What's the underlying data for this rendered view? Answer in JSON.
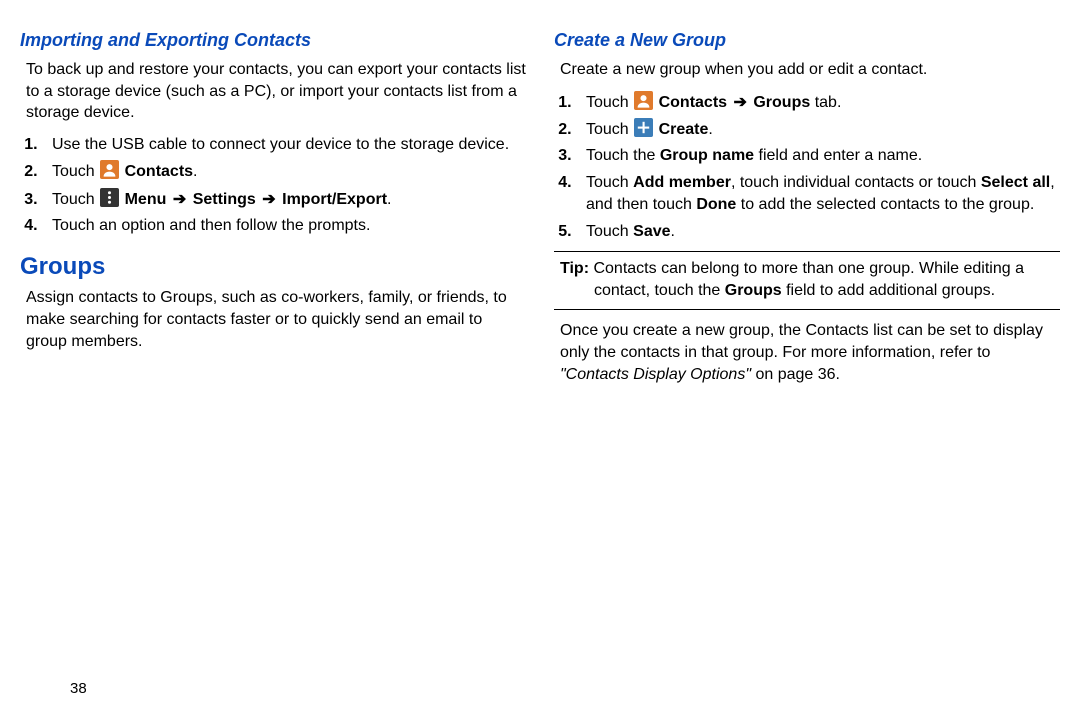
{
  "page_number": "38",
  "left": {
    "heading1": "Importing and Exporting Contacts",
    "para1": "To back up and restore your contacts, you can export your contacts list to a storage device (such as a PC), or import your contacts list from a storage device.",
    "step1": "Use the USB cable to connect your device to the storage device.",
    "step2_pre": "Touch ",
    "step2_bold": "Contacts",
    "step2_post": ".",
    "step3_pre": "Touch ",
    "step3_b1": "Menu",
    "step3_b2": "Settings",
    "step3_b3": "Import/Export",
    "step3_post": ".",
    "step4": "Touch an option and then follow the prompts.",
    "heading2": "Groups",
    "para2": "Assign contacts to Groups, such as co-workers, family, or friends, to make searching for contacts faster or to quickly send an email to group members."
  },
  "right": {
    "heading1": "Create a New Group",
    "para1": "Create a new group when you add or edit a contact.",
    "step1_pre": "Touch ",
    "step1_b1": "Contacts",
    "step1_b2": "Groups",
    "step1_post": " tab.",
    "step2_pre": "Touch ",
    "step2_b1": "Create",
    "step2_post": ".",
    "step3_pre": "Touch the ",
    "step3_b1": "Group name",
    "step3_post": " field and enter a name.",
    "step4_pre": "Touch ",
    "step4_b1": "Add member",
    "step4_mid1": ", touch individual contacts or touch ",
    "step4_b2": "Select all",
    "step4_mid2": ", and then touch ",
    "step4_b3": "Done",
    "step4_post": " to add the selected contacts to the group.",
    "step5_pre": "Touch ",
    "step5_b1": "Save",
    "step5_post": ".",
    "tip_label": "Tip:",
    "tip_body1": " Contacts can belong to more than one group. While editing a contact, touch the ",
    "tip_b1": "Groups",
    "tip_body2": " field to add additional groups.",
    "after_p1": "Once you create a new group, the Contacts list can be set to display only the contacts in that group. For more information, refer to ",
    "after_ref": "\"Contacts Display Options\"",
    "after_p2": " on page 36."
  },
  "icons": {
    "contacts": "contacts-icon",
    "menu": "menu-icon",
    "create": "plus-icon"
  },
  "arrow": "➔"
}
